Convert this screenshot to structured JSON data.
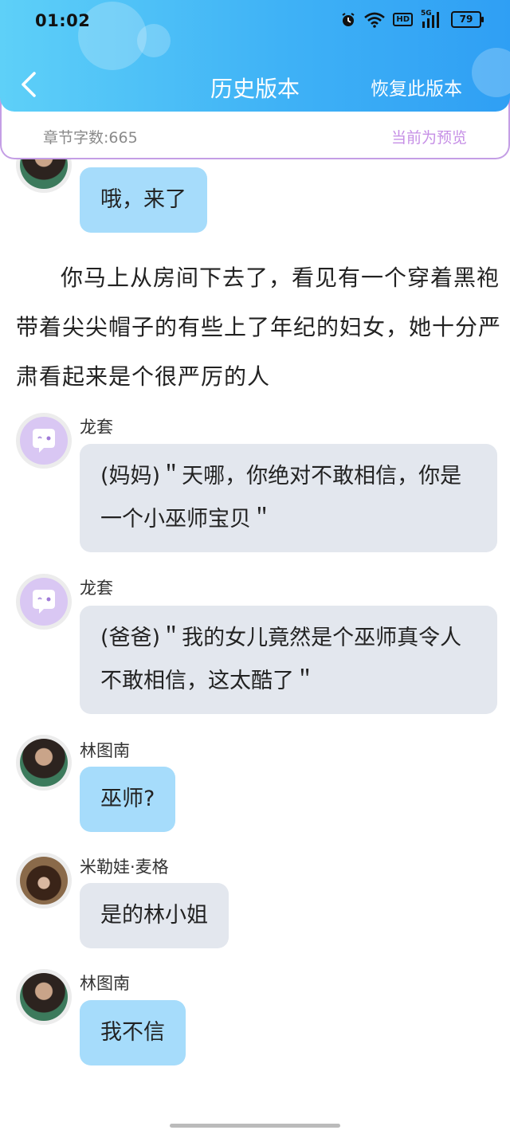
{
  "status_bar": {
    "time": "01:02",
    "battery": "79",
    "hd": "HD",
    "signal": "5G"
  },
  "header": {
    "title": "历史版本",
    "restore_label": "恢复此版本",
    "back_icon": "chevron-left-icon"
  },
  "info_bar": {
    "word_count": "章节字数:665",
    "preview_label": "当前为预览"
  },
  "messages": [
    {
      "type": "bubble",
      "speaker": "",
      "text": "哦，来了",
      "style": "blue"
    },
    {
      "type": "narration",
      "text": "你马上从房间下去了，看见有一个穿着黑袍带着尖尖帽子的有些上了年纪的妇女，她十分严肃看起来是个很严厉的人"
    },
    {
      "type": "bubble",
      "speaker": "龙套",
      "text": "(妈妈)＂天哪，你绝对不敢相信，你是一个小巫师宝贝＂",
      "style": "gray"
    },
    {
      "type": "bubble",
      "speaker": "龙套",
      "text": "(爸爸)＂我的女儿竟然是个巫师真令人不敢相信，这太酷了＂",
      "style": "gray"
    },
    {
      "type": "bubble",
      "speaker": "林图南",
      "text": "巫师?",
      "style": "blue"
    },
    {
      "type": "bubble",
      "speaker": "米勒娃·麦格",
      "text": "是的林小姐",
      "style": "gray"
    },
    {
      "type": "bubble",
      "speaker": "林图南",
      "text": "我不信",
      "style": "blue"
    }
  ],
  "colors": {
    "accent": "#3fb2f6",
    "bubble_blue": "#a6dcfb",
    "bubble_gray": "#e3e7ee",
    "preview_purple": "#c68fe6"
  }
}
